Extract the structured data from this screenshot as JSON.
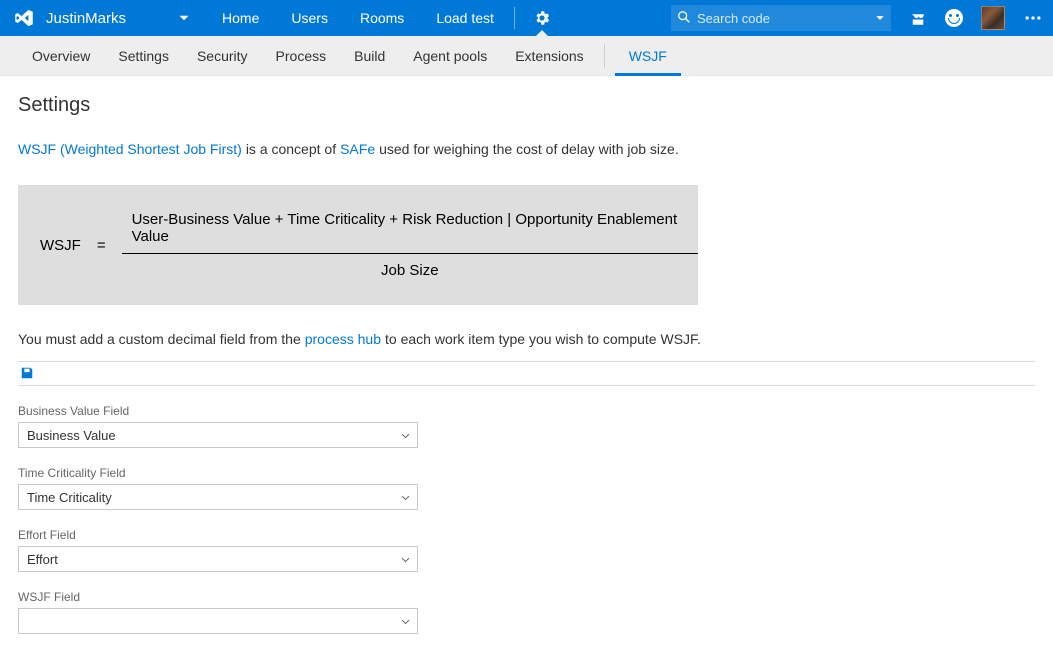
{
  "header": {
    "project": "JustinMarks",
    "nav": [
      "Home",
      "Users",
      "Rooms",
      "Load test"
    ],
    "search_placeholder": "Search code"
  },
  "subnav": {
    "tabs": [
      "Overview",
      "Settings",
      "Security",
      "Process",
      "Build",
      "Agent pools",
      "Extensions"
    ],
    "active_tab": "WSJF"
  },
  "page": {
    "title": "Settings",
    "intro_link1": "WSJF (Weighted Shortest Job First)",
    "intro_mid1": "is a concept of",
    "intro_link2": "SAFe",
    "intro_mid2": "used for weighing the cost of delay with job size.",
    "formula_left": "WSJF",
    "formula_eq": "=",
    "formula_num": "User-Business Value + Time Criticality  + Risk Reduction | Opportunity Enablement Value",
    "formula_den": "Job Size",
    "para2_a": "You must add a custom decimal field from the",
    "para2_link": "process hub",
    "para2_b": "to each work item type you wish to compute WSJF."
  },
  "fields": [
    {
      "label": "Business Value Field",
      "value": "Business Value"
    },
    {
      "label": "Time Criticality Field",
      "value": "Time Criticality"
    },
    {
      "label": "Effort Field",
      "value": "Effort"
    },
    {
      "label": "WSJF Field",
      "value": ""
    }
  ]
}
